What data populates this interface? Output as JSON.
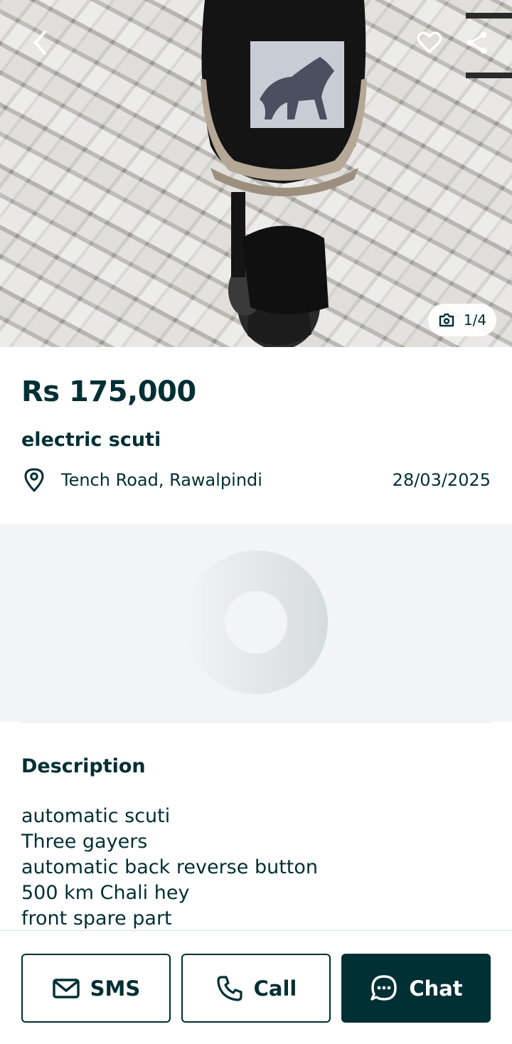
{
  "gallery": {
    "counter": "1/4",
    "icons": {
      "back": "chevron-left-icon",
      "favorite": "heart-icon",
      "share": "share-icon",
      "camera": "camera-icon"
    }
  },
  "listing": {
    "price": "Rs 175,000",
    "title": "electric scuti",
    "location": "Tench Road, Rawalpindi",
    "date": "28/03/2025"
  },
  "description": {
    "heading": "Description",
    "lines": [
      "automatic scuti",
      "Three gayers",
      "automatic back reverse button",
      "500 km Chali hey",
      "front spare part"
    ]
  },
  "actions": {
    "sms": "SMS",
    "call": "Call",
    "chat": "Chat"
  },
  "colors": {
    "brand_dark": "#002f34",
    "map_placeholder_bg": "#f2f4f5"
  }
}
